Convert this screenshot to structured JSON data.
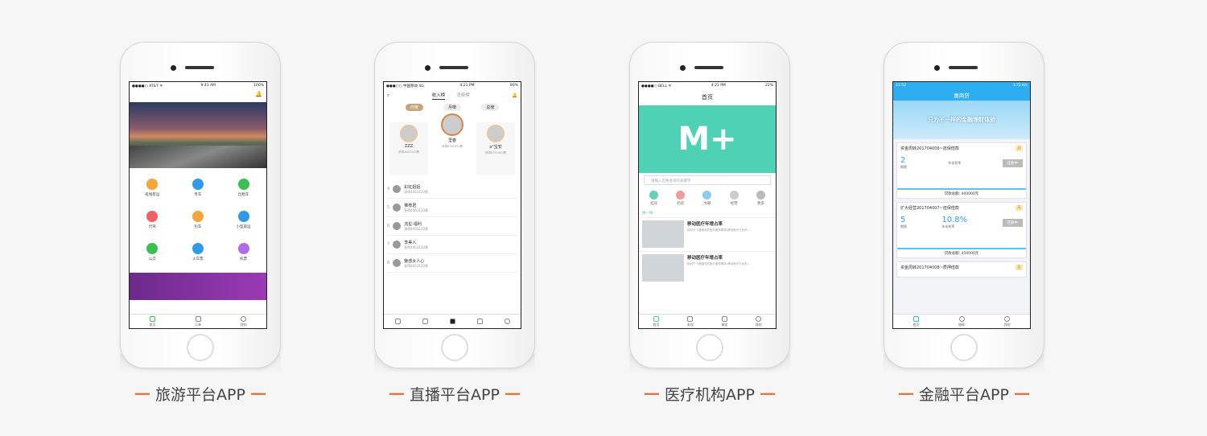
{
  "phones": [
    {
      "caption": "旅游平台APP",
      "status": {
        "carrier": "●●●●○ AT&T ᯤ",
        "time": "9:41 AM",
        "battery": "100%"
      },
      "grid": [
        {
          "label": "班线客运",
          "color": "#f4a63a"
        },
        {
          "label": "专车",
          "color": "#2f9ae6"
        },
        {
          "label": "出租车",
          "color": "#3cbf52"
        },
        {
          "label": "代驾",
          "color": "#f06060"
        },
        {
          "label": "包车",
          "color": "#f4a63a"
        },
        {
          "label": "小型旅运",
          "color": "#2f9ae6"
        },
        {
          "label": "公交",
          "color": "#3cbf52"
        },
        {
          "label": "火车票",
          "color": "#2f9ae6"
        },
        {
          "label": "机票",
          "color": "#b26be8"
        }
      ],
      "tabs": [
        "首页",
        "订单",
        "我的"
      ]
    },
    {
      "caption": "直播平台APP",
      "status": {
        "carrier": "●●●○○ 中国移动 4G",
        "time": "4:21 PM",
        "battery": "80%"
      },
      "top_tabs": [
        "收入榜",
        "消费榜"
      ],
      "pills": [
        "日榜",
        "月榜",
        "总榜"
      ],
      "podium": [
        {
          "name": "ZZZ",
          "sub": "获得4063120票"
        },
        {
          "name": "里春",
          "sub": "获得6761650票"
        },
        {
          "name": "a°宝安",
          "sub": "获得6761650票"
        }
      ],
      "rows": [
        {
          "rank": "4",
          "name": "彩虹姐姐",
          "sub": "获得4063120票"
        },
        {
          "rank": "5",
          "name": "推荐君",
          "sub": "获得4063120票"
        },
        {
          "rank": "6",
          "name": "流星-福利",
          "sub": "获得4063120票"
        },
        {
          "rank": "7",
          "name": "李美人",
          "sub": "获得4063120票"
        },
        {
          "rank": "8",
          "name": "魅惑女人心",
          "sub": "获得4063120票"
        }
      ]
    },
    {
      "caption": "医疗机构APP",
      "status": {
        "carrier": "●●●●○ BELL ᯤ",
        "time": "4:21 PM",
        "battery": "22%"
      },
      "title": "首页",
      "hero": "M+",
      "search_placeholder": "请输入您要查询的关键字",
      "icons": [
        {
          "label": "挂号",
          "color": "#62d3b9"
        },
        {
          "label": "药房",
          "color": "#f59a9a"
        },
        {
          "label": "文献",
          "color": "#8ec9f0"
        },
        {
          "label": "经营",
          "color": "#cccccc"
        },
        {
          "label": "更多",
          "color": "#bbbbbb"
        }
      ],
      "section": "换一换",
      "news": [
        {
          "title": "移动医疗年增占率",
          "body": "相对于飞速增长的医疗服务需求,移动医疗行业的..."
        },
        {
          "title": "移动医疗年增占率",
          "body": "相对于飞速增长的医疗服务需求,移动医疗行业的..."
        }
      ],
      "tabs": [
        "首页",
        "发现",
        "课程",
        "我的"
      ]
    },
    {
      "caption": "金融平台APP",
      "status": {
        "carrier": "11:52",
        "time": "",
        "battery": "3.72 K/s"
      },
      "title": "惠商贷",
      "banner": "只为不一样的金融理财体验",
      "loans": [
        {
          "name": "资金周转201704006~担保借款",
          "tag": "月",
          "term": "2",
          "rate": "",
          "btn": "还款中",
          "total": "贷款总额: 400000元"
        },
        {
          "name": "扩大经营201704007~担保借款",
          "tag": "月",
          "term": "5",
          "rate": "10.8%",
          "btn": "还款中",
          "total": "贷款总额: 450000元"
        },
        {
          "name": "资金周转201704008~质押借款",
          "tag": "月",
          "term": "",
          "rate": "",
          "btn": "",
          "total": ""
        }
      ],
      "labels": {
        "term": "期限",
        "rate": "年化利率"
      },
      "tabs": [
        "首页",
        "借款",
        "我的"
      ]
    }
  ]
}
